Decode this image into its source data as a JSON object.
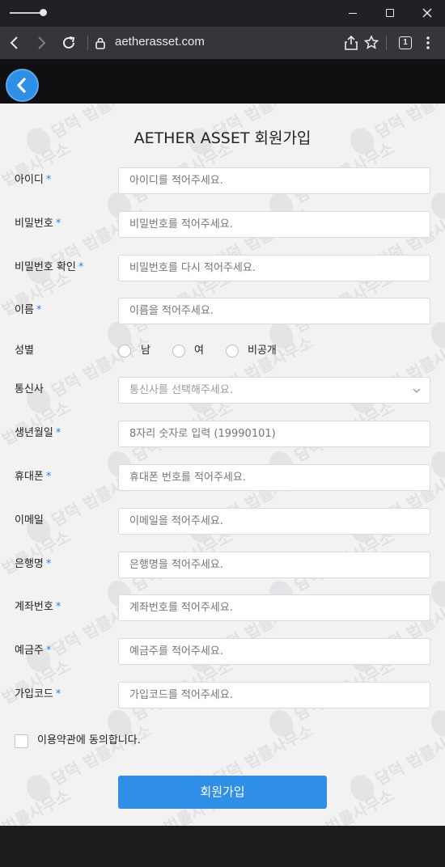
{
  "browser": {
    "url": "aetherasset.com",
    "tab_count": "1"
  },
  "page": {
    "title": "AETHER ASSET 회원가입",
    "required_mark": "*"
  },
  "fields": [
    {
      "label": "아이디",
      "required": true,
      "placeholder": "아이디를 적어주세요."
    },
    {
      "label": "비밀번호",
      "required": true,
      "placeholder": "비밀번호를 적어주세요."
    },
    {
      "label": "비밀번호 확인",
      "required": true,
      "placeholder": "비밀번호를 다시 적어주세요."
    },
    {
      "label": "이름",
      "required": true,
      "placeholder": "이름을 적어주세요."
    },
    {
      "label": "성별",
      "required": false,
      "options": [
        "남",
        "여",
        "비공개"
      ]
    },
    {
      "label": "통신사",
      "required": false,
      "placeholder": "통신사를 선택해주세요."
    },
    {
      "label": "생년월일",
      "required": true,
      "placeholder": "8자리 숫자로 입력 (19990101)"
    },
    {
      "label": "휴대폰",
      "required": true,
      "placeholder": "휴대폰 번호를 적어주세요."
    },
    {
      "label": "이메일",
      "required": false,
      "placeholder": "이메일을 적어주세요."
    },
    {
      "label": "은행명",
      "required": true,
      "placeholder": "은행명을 적어주세요."
    },
    {
      "label": "계좌번호",
      "required": true,
      "placeholder": "계좌번호를 적어주세요."
    },
    {
      "label": "예금주",
      "required": true,
      "placeholder": "예금주를 적어주세요."
    },
    {
      "label": "가입코드",
      "required": true,
      "placeholder": "가입코드를 적어주세요."
    }
  ],
  "agreement": {
    "label": "이용약관에 동의합니다."
  },
  "submit": {
    "label": "회원가입"
  },
  "watermark_text": "담덕 법률사무소",
  "colors": {
    "accent": "#2f8fe6",
    "required": "#2f7fe8",
    "background": "#f2f2f3"
  }
}
